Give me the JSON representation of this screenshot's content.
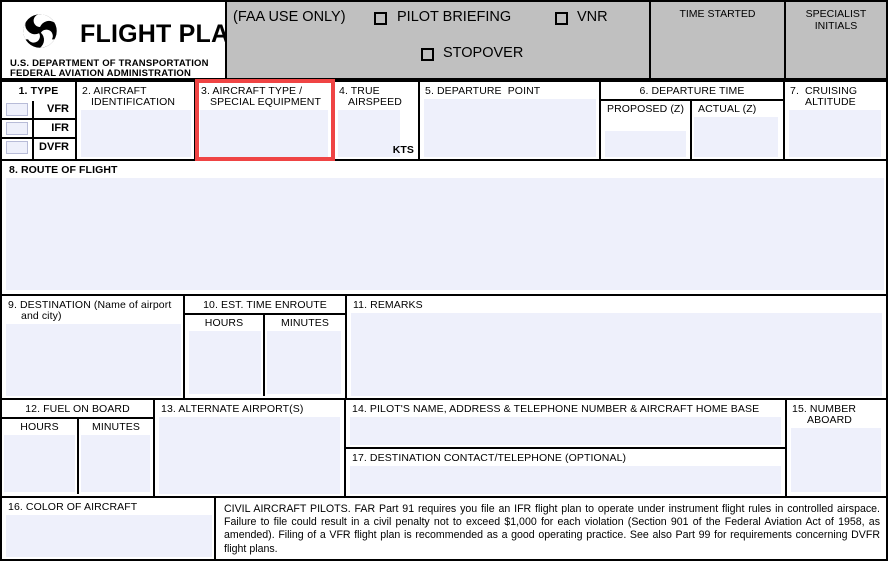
{
  "document": {
    "title": "FLIGHT PLAN",
    "agency_line_1": "U.S. DEPARTMENT OF TRANSPORTATION",
    "agency_line_2": "FEDERAL AVIATION ADMINISTRATION",
    "logo": "dot-triskelion-logo"
  },
  "header": {
    "faa_use_only": "(FAA USE ONLY)",
    "checkboxes": [
      {
        "label": "PILOT BRIEFING",
        "checked": false
      },
      {
        "label": "VNR",
        "checked": false
      },
      {
        "label": "STOPOVER",
        "checked": false
      }
    ],
    "time_started": "TIME STARTED",
    "specialist_initials_line_1": "SPECIALIST",
    "specialist_initials_line_2": "INITIALS",
    "time_started_value": "",
    "specialist_initials_value": ""
  },
  "fields": {
    "f1": {
      "label": "1. TYPE",
      "options": [
        {
          "label": "VFR",
          "value": ""
        },
        {
          "label": "IFR",
          "value": ""
        },
        {
          "label": "DVFR",
          "value": ""
        }
      ]
    },
    "f2": {
      "label_line_1": "2. AIRCRAFT",
      "label_line_2": "IDENTIFICATION",
      "value": ""
    },
    "f3": {
      "label_line_1": "3. AIRCRAFT TYPE /",
      "label_line_2": "SPECIAL EQUIPMENT",
      "value": "",
      "highlighted": true,
      "highlight_color": "#ef4444"
    },
    "f4": {
      "label_line_1": "4. TRUE",
      "label_line_2": "AIRSPEED",
      "unit": "KTS",
      "value": ""
    },
    "f5": {
      "label": "5. DEPARTURE  POINT",
      "value": ""
    },
    "f6": {
      "label": "6. DEPARTURE TIME",
      "sub_proposed": "PROPOSED (Z)",
      "sub_actual": "ACTUAL (Z)",
      "proposed_value": "",
      "actual_value": ""
    },
    "f7": {
      "label_line_1": "7.  CRUISING",
      "label_line_2": "ALTITUDE",
      "value": ""
    },
    "f8": {
      "label": "8. ROUTE OF FLIGHT",
      "value": ""
    },
    "f9": {
      "label_line_1": "9. DESTINATION (Name of airport",
      "label_line_2": "and city)",
      "value": ""
    },
    "f10": {
      "label": "10. EST. TIME ENROUTE",
      "sub_hours": "HOURS",
      "sub_minutes": "MINUTES",
      "hours_value": "",
      "minutes_value": ""
    },
    "f11": {
      "label": "11. REMARKS",
      "value": ""
    },
    "f12": {
      "label": "12. FUEL ON BOARD",
      "sub_hours": "HOURS",
      "sub_minutes": "MINUTES",
      "hours_value": "",
      "minutes_value": ""
    },
    "f13": {
      "label": "13. ALTERNATE AIRPORT(S)",
      "value": ""
    },
    "f14": {
      "label": "14. PILOT'S NAME, ADDRESS & TELEPHONE NUMBER & AIRCRAFT HOME BASE",
      "value": ""
    },
    "f15": {
      "label_line_1": "15. NUMBER",
      "label_line_2": "ABOARD",
      "value": ""
    },
    "f16": {
      "label": "16. COLOR OF AIRCRAFT",
      "value": ""
    },
    "f17": {
      "label": "17. DESTINATION CONTACT/TELEPHONE (OPTIONAL)",
      "value": ""
    }
  },
  "notice": {
    "text": "CIVIL  AIRCRAFT PILOTS. FAR Part 91 requires you file an IFR flight plan to operate under instrument flight rules in controlled airspace.   Failure to file could result in a civil penalty not to exceed $1,000 for each violation (Section 901 of the Federal Aviation Act of 1958, as amended).    Filing of a VFR flight plan is recommended as a good operating practice.      See also Part 99 for requirements concerning DVFR flight plans."
  },
  "colors": {
    "field_fill": "#eef0fb",
    "header_gray": "#c0c0c0",
    "border": "#000000",
    "highlight": "#ef4444"
  }
}
